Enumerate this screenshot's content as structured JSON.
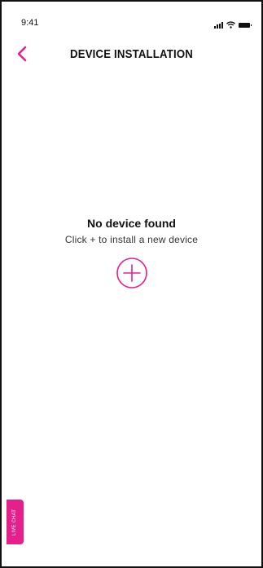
{
  "status_bar": {
    "time": "9:41",
    "icons": [
      "signal-icon",
      "wifi-icon",
      "battery-icon"
    ]
  },
  "header": {
    "title": "DEVICE INSTALLATION",
    "back_icon": "chevron-left-icon"
  },
  "empty_state": {
    "title": "No device found",
    "subtitle": "Click + to install a new device",
    "add_icon": "plus-circle-icon"
  },
  "live_chat": {
    "label": "LIVE CHAT"
  },
  "colors": {
    "accent": "#e5208c",
    "text": "#111111",
    "background": "#ffffff"
  }
}
